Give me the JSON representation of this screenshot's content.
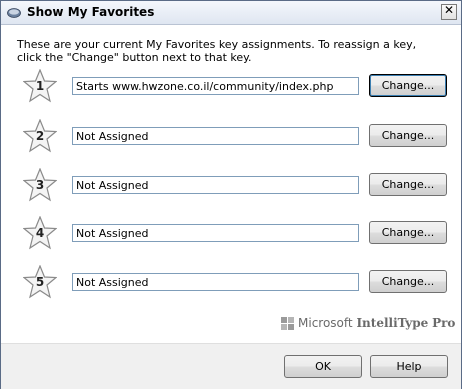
{
  "window": {
    "title": "Show My Favorites",
    "close_icon": "close-icon"
  },
  "intro": "These are your current My Favorites key assignments. To reassign a key, click the \"Change\" button next to that key.",
  "favorites": [
    {
      "number": "1",
      "value": "Starts www.hwzone.co.il/community/index.php",
      "button": "Change...",
      "icon": "star-icon"
    },
    {
      "number": "2",
      "value": "Not Assigned",
      "button": "Change...",
      "icon": "star-icon"
    },
    {
      "number": "3",
      "value": "Not Assigned",
      "button": "Change...",
      "icon": "star-icon"
    },
    {
      "number": "4",
      "value": "Not Assigned",
      "button": "Change...",
      "icon": "star-icon"
    },
    {
      "number": "5",
      "value": "Not Assigned",
      "button": "Change...",
      "icon": "star-icon"
    }
  ],
  "branding": {
    "company": "Microsoft",
    "product_a": "IntelliType",
    "product_b": "Pro"
  },
  "footer": {
    "ok_label": "OK",
    "help_label": "Help"
  },
  "colors": {
    "title_bar": "#e6ecf5",
    "footer_bg": "#f0f0f0",
    "field_border": "#7f9db9"
  }
}
